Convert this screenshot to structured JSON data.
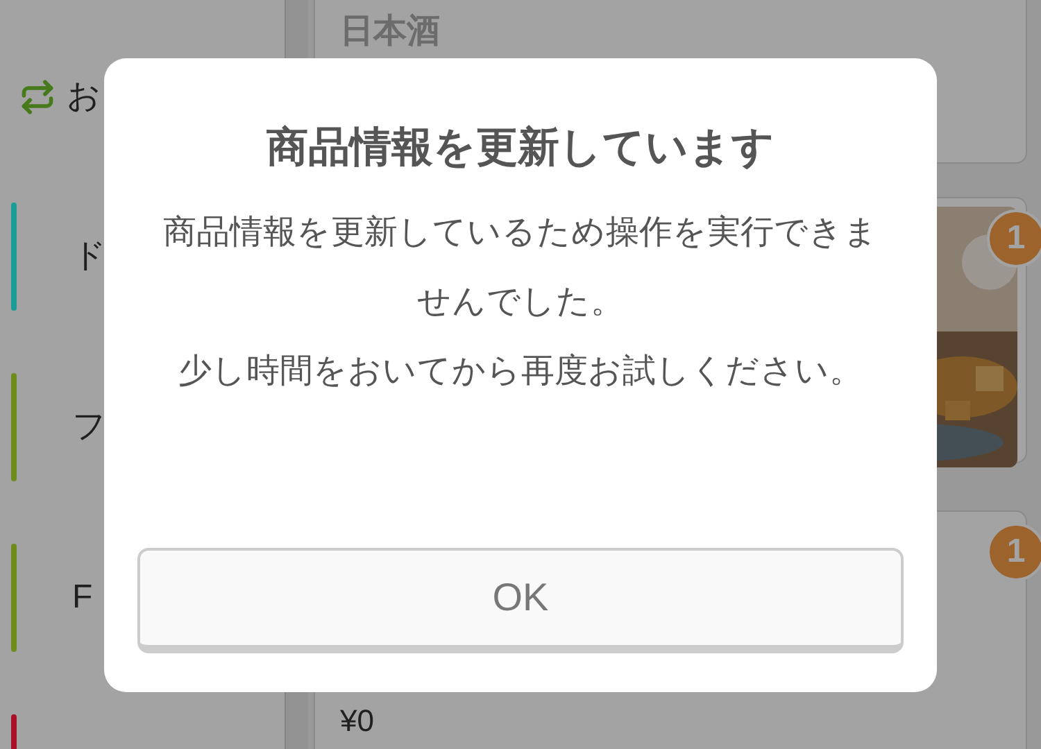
{
  "sidebar": {
    "reorder": {
      "label": "お"
    },
    "categories": [
      {
        "label": "ド",
        "color": "#1c9c96"
      },
      {
        "label": "フ",
        "color": "#6e8c1a"
      },
      {
        "label": "F",
        "color": "#6e8c1a"
      },
      {
        "color": "#a8102a"
      }
    ]
  },
  "cards": [
    {
      "kind": "title",
      "title": "日本酒"
    },
    {
      "kind": "picture",
      "badge": "1"
    },
    {
      "kind": "price",
      "badge": "1",
      "price": "¥0"
    }
  ],
  "dialog": {
    "title": "商品情報を更新しています",
    "message": [
      "商品情報を更新しているため操作を実行できませんでした。",
      "少し時間をおいてから再度お試しください。"
    ],
    "button": "OK"
  }
}
